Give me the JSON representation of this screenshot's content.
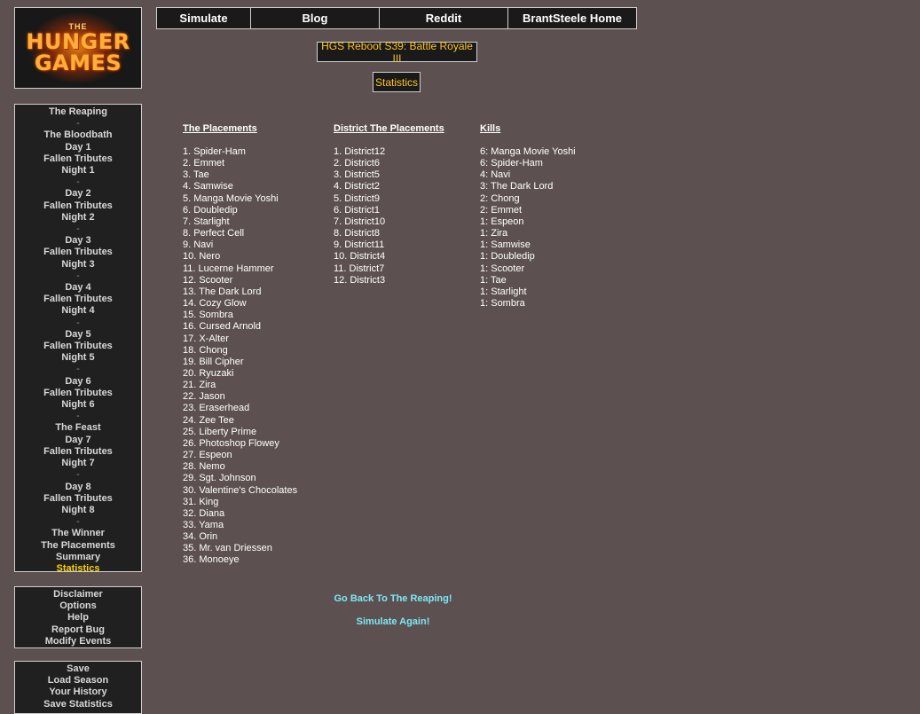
{
  "logo": {
    "line1": "THE",
    "line2": "HUNGER",
    "line3": "GAMES"
  },
  "topnav": [
    {
      "label": "Simulate",
      "w": 106
    },
    {
      "label": "Blog",
      "w": 145
    },
    {
      "label": "Reddit",
      "w": 145
    },
    {
      "label": "BrantSteele Home",
      "w": 144
    }
  ],
  "season_title": "HGS Reboot S39: Battle Royale III",
  "page_label": "Statistics",
  "sidebar_main": [
    "The Reaping",
    "-",
    "The Bloodbath",
    "Day 1",
    "Fallen Tributes",
    "Night 1",
    "-",
    "Day 2",
    "Fallen Tributes",
    "Night 2",
    "-",
    "Day 3",
    "Fallen Tributes",
    "Night 3",
    "-",
    "Day 4",
    "Fallen Tributes",
    "Night 4",
    "-",
    "Day 5",
    "Fallen Tributes",
    "Night 5",
    "-",
    "Day 6",
    "Fallen Tributes",
    "Night 6",
    "-",
    "The Feast",
    "Day 7",
    "Fallen Tributes",
    "Night 7",
    "-",
    "Day 8",
    "Fallen Tributes",
    "Night 8",
    "-",
    "The Winner",
    "The Placements",
    "Summary",
    "Statistics"
  ],
  "sidebar_active": "Statistics",
  "sidebar_util": [
    "Disclaimer",
    "Options",
    "Help",
    "Report Bug",
    "Modify Events"
  ],
  "sidebar_save": [
    "Save",
    "Load Season",
    "Your History",
    "Save Statistics"
  ],
  "placements": {
    "heading": "The Placements",
    "items": [
      "1. Spider-Ham",
      "2. Emmet",
      "3. Tae",
      "4. Samwise",
      "5. Manga Movie Yoshi",
      "6. Doubledip",
      "7. Starlight",
      "8. Perfect Cell",
      "9. Navi",
      "10. Nero",
      "11. Lucerne Hammer",
      "12. Scooter",
      "13. The Dark Lord",
      "14. Cozy Glow",
      "15. Sombra",
      "16. Cursed Arnold",
      "17. X-Alter",
      "18. Chong",
      "19. Bill Cipher",
      "20. Ryuzaki",
      "21. Zira",
      "22. Jason",
      "23. Eraserhead",
      "24. Zee Tee",
      "25. Liberty Prime",
      "26. Photoshop Flowey",
      "27. Espeon",
      "28. Nemo",
      "29. Sgt. Johnson",
      "30. Valentine's Chocolates",
      "31. King",
      "32. Diana",
      "33. Yama",
      "34. Orin",
      "35. Mr. van Driessen",
      "36. Monoeye"
    ]
  },
  "district_placements": {
    "heading": "District The Placements",
    "items": [
      "1. District12",
      "2. District6",
      "3. District5",
      "4. District2",
      "5. District9",
      "6. District1",
      "7. District10",
      "8. District8",
      "9. District11",
      "10. District4",
      "11. District7",
      "12. District3"
    ]
  },
  "kills": {
    "heading": "Kills",
    "items": [
      "6: Manga Movie Yoshi",
      "6: Spider-Ham",
      "4: Navi",
      "3: The Dark Lord",
      "2: Chong",
      "2: Emmet",
      "1: Espeon",
      "1: Zira",
      "1: Samwise",
      "1: Doubledip",
      "1: Scooter",
      "1: Tae",
      "1: Starlight",
      "1: Sombra"
    ]
  },
  "links": {
    "back": "Go Back To The Reaping!",
    "again": "Simulate Again!"
  },
  "colors": {
    "background": "#5c5150",
    "accent": "#ffc520",
    "link": "#7ee7f8"
  }
}
